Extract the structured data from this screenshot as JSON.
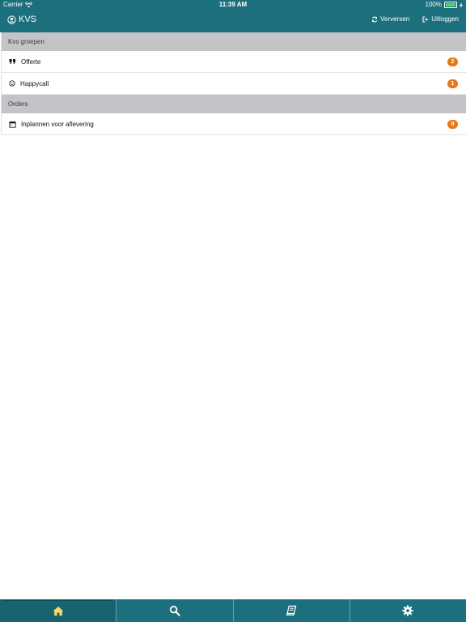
{
  "status_bar": {
    "carrier": "Carrier",
    "time": "11:39 AM",
    "battery": "100%"
  },
  "header": {
    "title": "KVS",
    "refresh_label": "Verversen",
    "logout_label": "Uitloggen"
  },
  "sections": [
    {
      "title": "Kvs groepen",
      "items": [
        {
          "label": "Offerte",
          "icon": "quote-icon",
          "count": "2"
        },
        {
          "label": "Happycall",
          "icon": "smiley-icon",
          "count": "1"
        }
      ]
    },
    {
      "title": "Orders",
      "items": [
        {
          "label": "Inplannen voor aflevering",
          "icon": "calendar-icon",
          "count": "0"
        }
      ]
    }
  ],
  "tabbar": {
    "tabs": [
      {
        "icon": "home-icon",
        "active": true
      },
      {
        "icon": "search-icon",
        "active": false
      },
      {
        "icon": "book-icon",
        "active": false
      },
      {
        "icon": "gear-icon",
        "active": false
      }
    ]
  },
  "colors": {
    "primary": "#1c6f7c",
    "section_header": "#c3c4c7",
    "badge": "#e4791b",
    "active_icon": "#f5d76e"
  }
}
